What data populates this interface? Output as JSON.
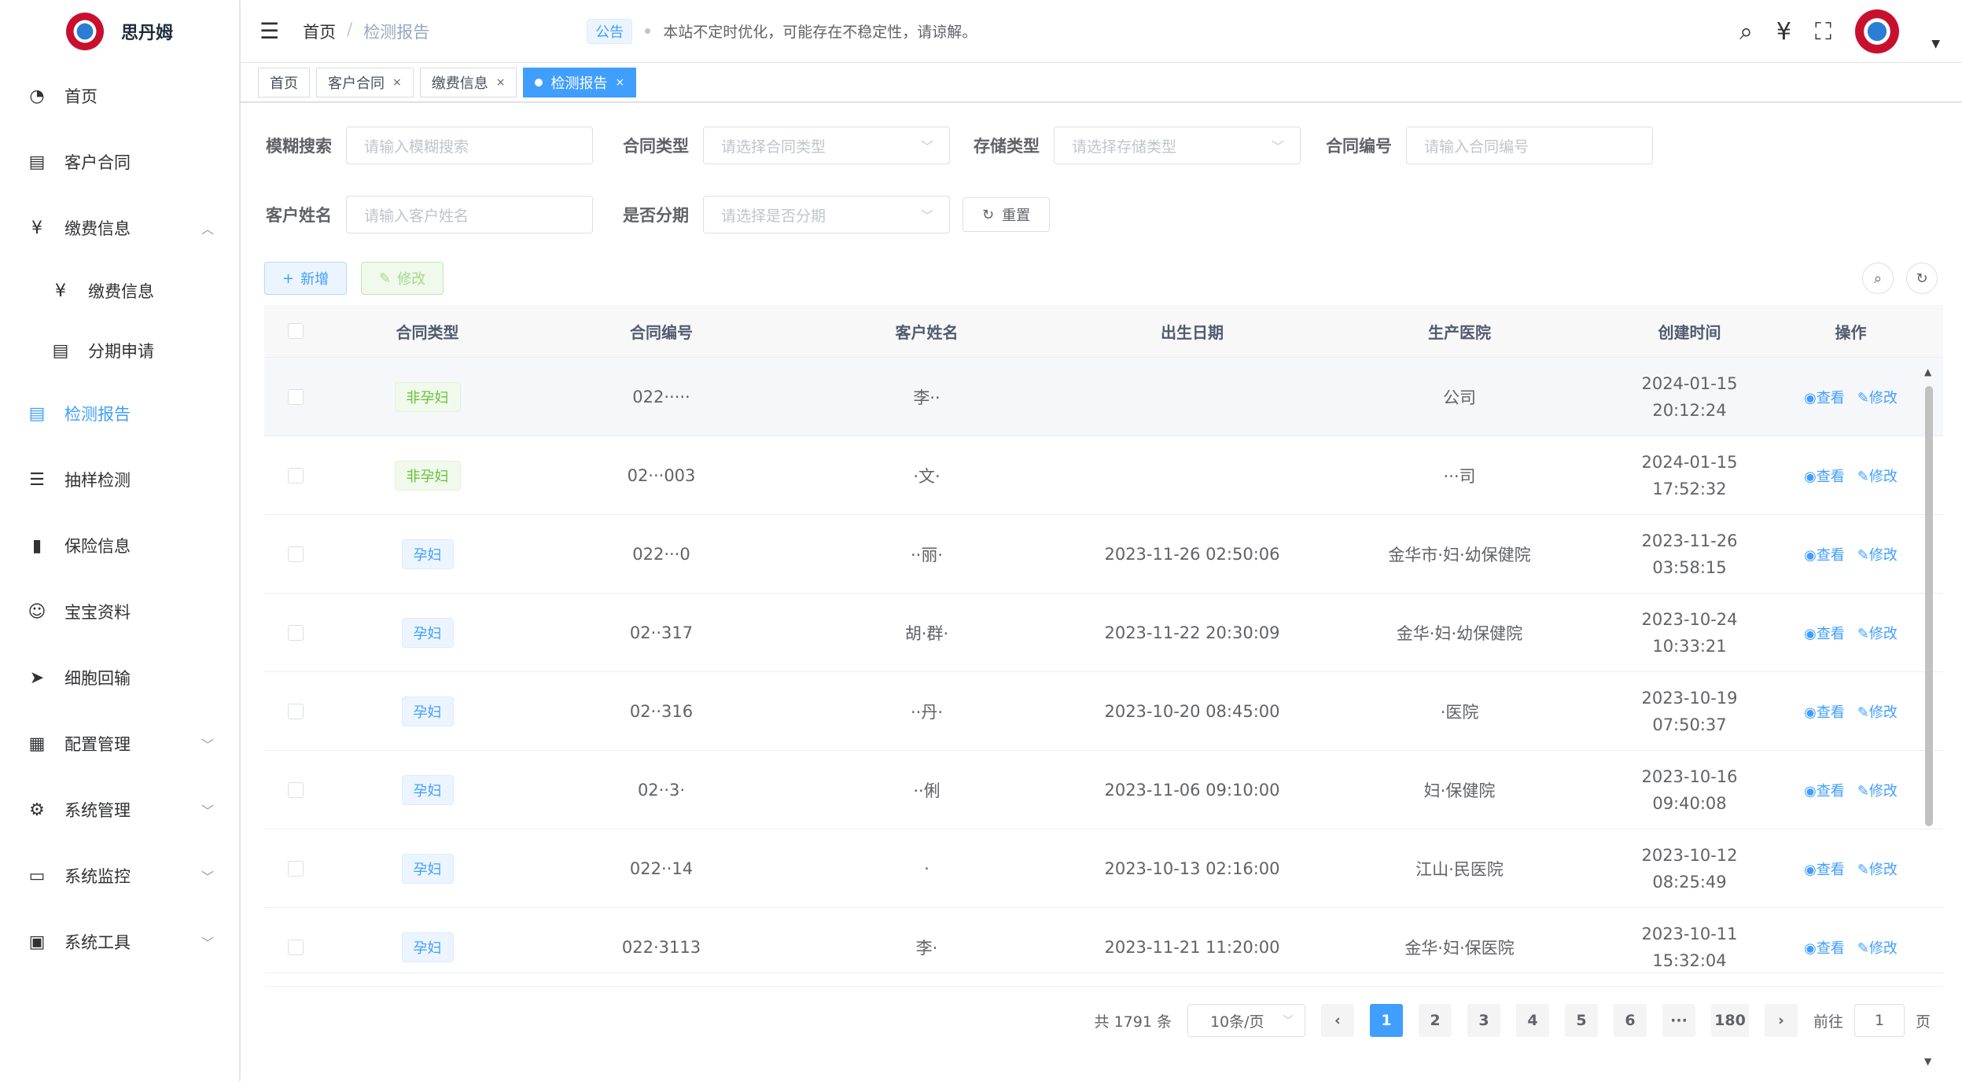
{
  "app": {
    "title": "思丹姆"
  },
  "sidebar": {
    "items": [
      {
        "label": "首页",
        "icon": "dashboard-icon"
      },
      {
        "label": "客户合同",
        "icon": "contract-icon"
      },
      {
        "label": "缴费信息",
        "icon": "yen-icon",
        "expanded": true
      },
      {
        "label": "缴费信息",
        "icon": "yen-icon",
        "sub": true
      },
      {
        "label": "分期申请",
        "icon": "document-icon",
        "sub": true
      },
      {
        "label": "检测报告",
        "icon": "document-icon",
        "active": true
      },
      {
        "label": "抽样检测",
        "icon": "list-icon"
      },
      {
        "label": "保险信息",
        "icon": "insurance-icon"
      },
      {
        "label": "宝宝资料",
        "icon": "baby-icon"
      },
      {
        "label": "细胞回输",
        "icon": "send-icon"
      },
      {
        "label": "配置管理",
        "icon": "config-icon"
      },
      {
        "label": "系统管理",
        "icon": "gear-icon"
      },
      {
        "label": "系统监控",
        "icon": "monitor-icon"
      },
      {
        "label": "系统工具",
        "icon": "toolbox-icon"
      }
    ]
  },
  "header": {
    "breadcrumb": [
      "首页",
      "检测报告"
    ],
    "notice_tag": "公告",
    "notice_text": "本站不定时优化，可能存在不稳定性，请谅解。",
    "icons": [
      "search-icon",
      "yen-icon",
      "fullscreen-icon"
    ]
  },
  "tags": [
    {
      "label": "首页"
    },
    {
      "label": "客户合同"
    },
    {
      "label": "缴费信息"
    },
    {
      "label": "检测报告",
      "active": true
    }
  ],
  "filters": {
    "fuzzy": {
      "label": "模糊搜索",
      "placeholder": "请输入模糊搜索"
    },
    "contract_type": {
      "label": "合同类型",
      "placeholder": "请选择合同类型"
    },
    "storage_type": {
      "label": "存储类型",
      "placeholder": "请选择存储类型"
    },
    "contract_no": {
      "label": "合同编号",
      "placeholder": "请输入合同编号"
    },
    "customer_name": {
      "label": "客户姓名",
      "placeholder": "请输入客户姓名"
    },
    "installment": {
      "label": "是否分期",
      "placeholder": "请选择是否分期"
    },
    "reset": "重置"
  },
  "toolbar": {
    "add": "新增",
    "edit": "修改"
  },
  "table": {
    "headers": [
      "合同类型",
      "合同编号",
      "客户姓名",
      "出生日期",
      "生产医院",
      "创建时间",
      "操作"
    ],
    "rows": [
      {
        "type": "非孕妇",
        "type_color": "green",
        "no": "022·····",
        "name": "李··",
        "birth": "",
        "hospital": "公司",
        "created_date": "2024-01-15",
        "created_time": "20:12:24"
      },
      {
        "type": "非孕妇",
        "type_color": "green",
        "no": "02···003",
        "name": "·文·",
        "birth": "",
        "hospital": "···司",
        "created_date": "2024-01-15",
        "created_time": "17:52:32"
      },
      {
        "type": "孕妇",
        "type_color": "blue",
        "no": "022···0",
        "name": "··丽·",
        "birth": "2023-11-26 02:50:06",
        "hospital": "金华市·妇·幼保健院",
        "created_date": "2023-11-26",
        "created_time": "03:58:15"
      },
      {
        "type": "孕妇",
        "type_color": "blue",
        "no": "02··317",
        "name": "胡·群·",
        "birth": "2023-11-22 20:30:09",
        "hospital": "金华·妇·幼保健院",
        "created_date": "2023-10-24",
        "created_time": "10:33:21"
      },
      {
        "type": "孕妇",
        "type_color": "blue",
        "no": "02··316",
        "name": "··丹·",
        "birth": "2023-10-20 08:45:00",
        "hospital": "·医院",
        "created_date": "2023-10-19",
        "created_time": "07:50:37"
      },
      {
        "type": "孕妇",
        "type_color": "blue",
        "no": "02··3·",
        "name": "··俐",
        "birth": "2023-11-06 09:10:00",
        "hospital": "妇·保健院",
        "created_date": "2023-10-16",
        "created_time": "09:40:08"
      },
      {
        "type": "孕妇",
        "type_color": "blue",
        "no": "022··14",
        "name": "·",
        "birth": "2023-10-13 02:16:00",
        "hospital": "江山·民医院",
        "created_date": "2023-10-12",
        "created_time": "08:25:49"
      },
      {
        "type": "孕妇",
        "type_color": "blue",
        "no": "022·3113",
        "name": "李·",
        "birth": "2023-11-21 11:20:00",
        "hospital": "金华·妇·保医院",
        "created_date": "2023-10-11",
        "created_time": "15:32:04"
      }
    ],
    "op_view": "查看",
    "op_edit": "修改"
  },
  "pagination": {
    "total": "共 1791 条",
    "page_size": "10条/页",
    "pages": [
      "1",
      "2",
      "3",
      "4",
      "5",
      "6",
      "···",
      "180"
    ],
    "current": "1",
    "goto_label": "前往",
    "goto_value": "1",
    "goto_suffix": "页"
  }
}
